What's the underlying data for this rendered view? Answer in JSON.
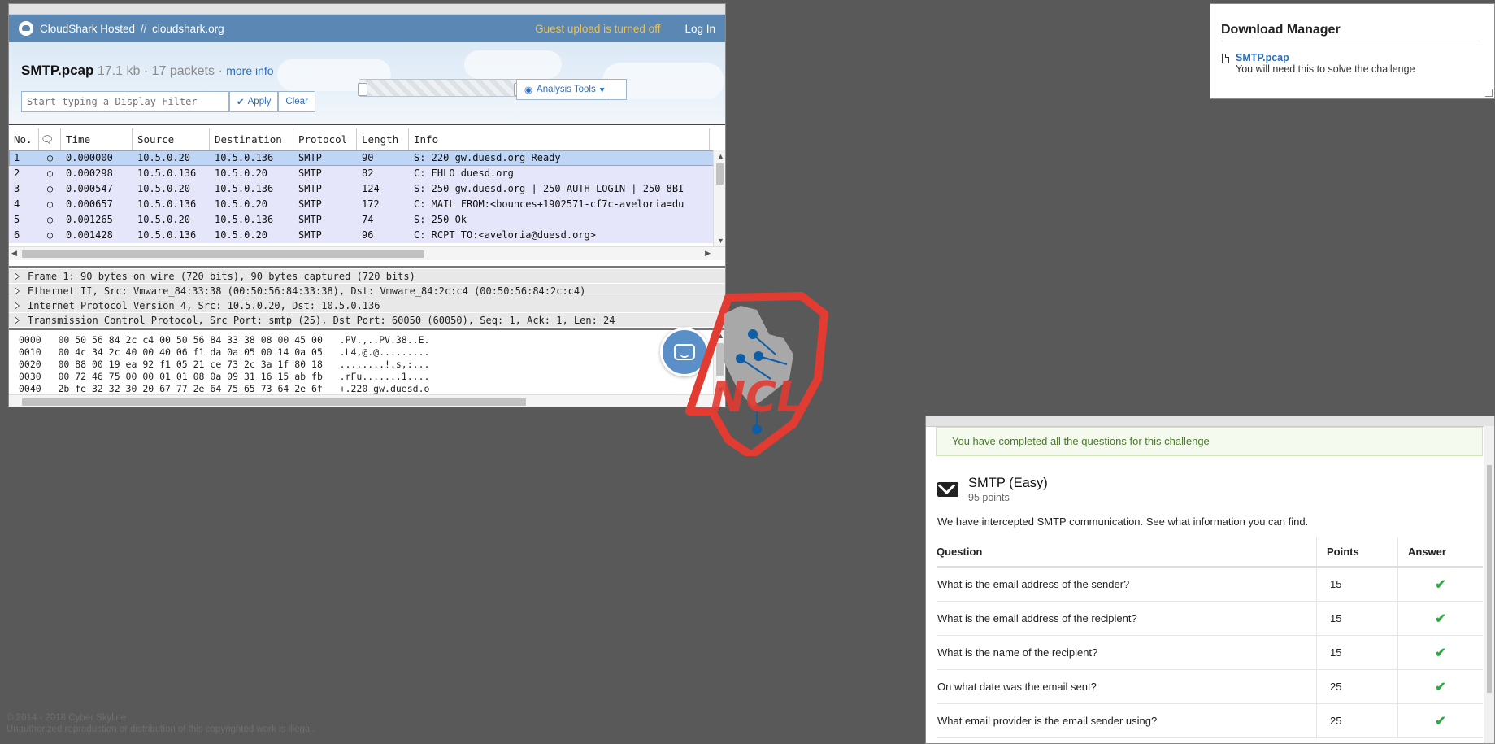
{
  "cloudshark": {
    "brand": "CloudShark Hosted",
    "brand_sep": "//",
    "brand_domain": "cloudshark.org",
    "guest_notice": "Guest upload is turned off",
    "login_label": "Log In",
    "filename": "SMTP.pcap",
    "file_size": "17.1 kb",
    "packet_count": "17 packets",
    "dot": "·",
    "more_info": "more info",
    "filter_placeholder": "Start typing a Display Filter",
    "apply_label": "Apply",
    "clear_label": "Clear",
    "analysis_tools_label": "Analysis Tools",
    "columns": [
      "No.",
      "",
      "Time",
      "Source",
      "Destination",
      "Protocol",
      "Length",
      "Info"
    ],
    "packets": [
      {
        "no": "1",
        "time": "0.000000",
        "src": "10.5.0.20",
        "dst": "10.5.0.136",
        "proto": "SMTP",
        "len": "90",
        "info": "S: 220 gw.duesd.org Ready"
      },
      {
        "no": "2",
        "time": "0.000298",
        "src": "10.5.0.136",
        "dst": "10.5.0.20",
        "proto": "SMTP",
        "len": "82",
        "info": "C: EHLO duesd.org"
      },
      {
        "no": "3",
        "time": "0.000547",
        "src": "10.5.0.20",
        "dst": "10.5.0.136",
        "proto": "SMTP",
        "len": "124",
        "info": "S: 250-gw.duesd.org | 250-AUTH LOGIN | 250-8BI"
      },
      {
        "no": "4",
        "time": "0.000657",
        "src": "10.5.0.136",
        "dst": "10.5.0.20",
        "proto": "SMTP",
        "len": "172",
        "info": "C: MAIL FROM:<bounces+1902571-cf7c-aveloria=du"
      },
      {
        "no": "5",
        "time": "0.001265",
        "src": "10.5.0.20",
        "dst": "10.5.0.136",
        "proto": "SMTP",
        "len": "74",
        "info": "S: 250 Ok"
      },
      {
        "no": "6",
        "time": "0.001428",
        "src": "10.5.0.136",
        "dst": "10.5.0.20",
        "proto": "SMTP",
        "len": "96",
        "info": "C: RCPT TO:<aveloria@duesd.org>"
      }
    ],
    "details": [
      "Frame 1: 90 bytes on wire (720 bits), 90 bytes captured (720 bits)",
      "Ethernet II, Src: Vmware_84:33:38 (00:50:56:84:33:38), Dst: Vmware_84:2c:c4 (00:50:56:84:2c:c4)",
      "Internet Protocol Version 4, Src: 10.5.0.20, Dst: 10.5.0.136",
      "Transmission Control Protocol, Src Port: smtp (25), Dst Port: 60050 (60050), Seq: 1, Ack: 1, Len: 24"
    ],
    "hex_lines": [
      "0000   00 50 56 84 2c c4 00 50 56 84 33 38 08 00 45 00   .PV.,..PV.38..E.",
      "0010   00 4c 34 2c 40 00 40 06 f1 da 0a 05 00 14 0a 05   .L4,@.@.........",
      "0020   00 88 00 19 ea 92 f1 05 21 ce 73 2c 3a 1f 80 18   ........!.s,:...",
      "0030   00 72 46 75 00 00 01 01 08 0a 09 31 16 15 ab fb   .rFu.......1....",
      "0040   2b fe 32 32 30 20 67 77 2e 64 75 65 73 64 2e 6f   +.220 gw.duesd.o"
    ]
  },
  "download_manager": {
    "title": "Download Manager",
    "file_link": "SMTP.pcap",
    "file_desc": "You will need this to solve the challenge"
  },
  "challenge": {
    "success_message": "You have completed all the questions for this challenge",
    "title": "SMTP (Easy)",
    "points": "95 points",
    "description": "We have intercepted SMTP communication. See what information you can find.",
    "columns": [
      "Question",
      "Points",
      "Answer"
    ],
    "questions": [
      {
        "q": "What is the email address of the sender?",
        "pts": "15"
      },
      {
        "q": "What is the email address of the recipient?",
        "pts": "15"
      },
      {
        "q": "What is the name of the recipient?",
        "pts": "15"
      },
      {
        "q": "On what date was the email sent?",
        "pts": "25"
      },
      {
        "q": "What email provider is the email sender using?",
        "pts": "25"
      }
    ],
    "check_glyph": "✔",
    "colors": {
      "success": "#2fa843"
    }
  },
  "footer": {
    "line1": "© 2014 - 2018 Cyber Skyline",
    "line2": "Unauthorized reproduction or distribution of this copyrighted work is illegal."
  },
  "logo": {
    "text": "NCL",
    "color": "#e23b32"
  },
  "icons": {
    "comment": "comment-icon",
    "check": "check-icon",
    "bulb": "lightbulb-icon",
    "file": "file-icon",
    "mail": "envelope-icon",
    "chat": "chat-icon"
  }
}
